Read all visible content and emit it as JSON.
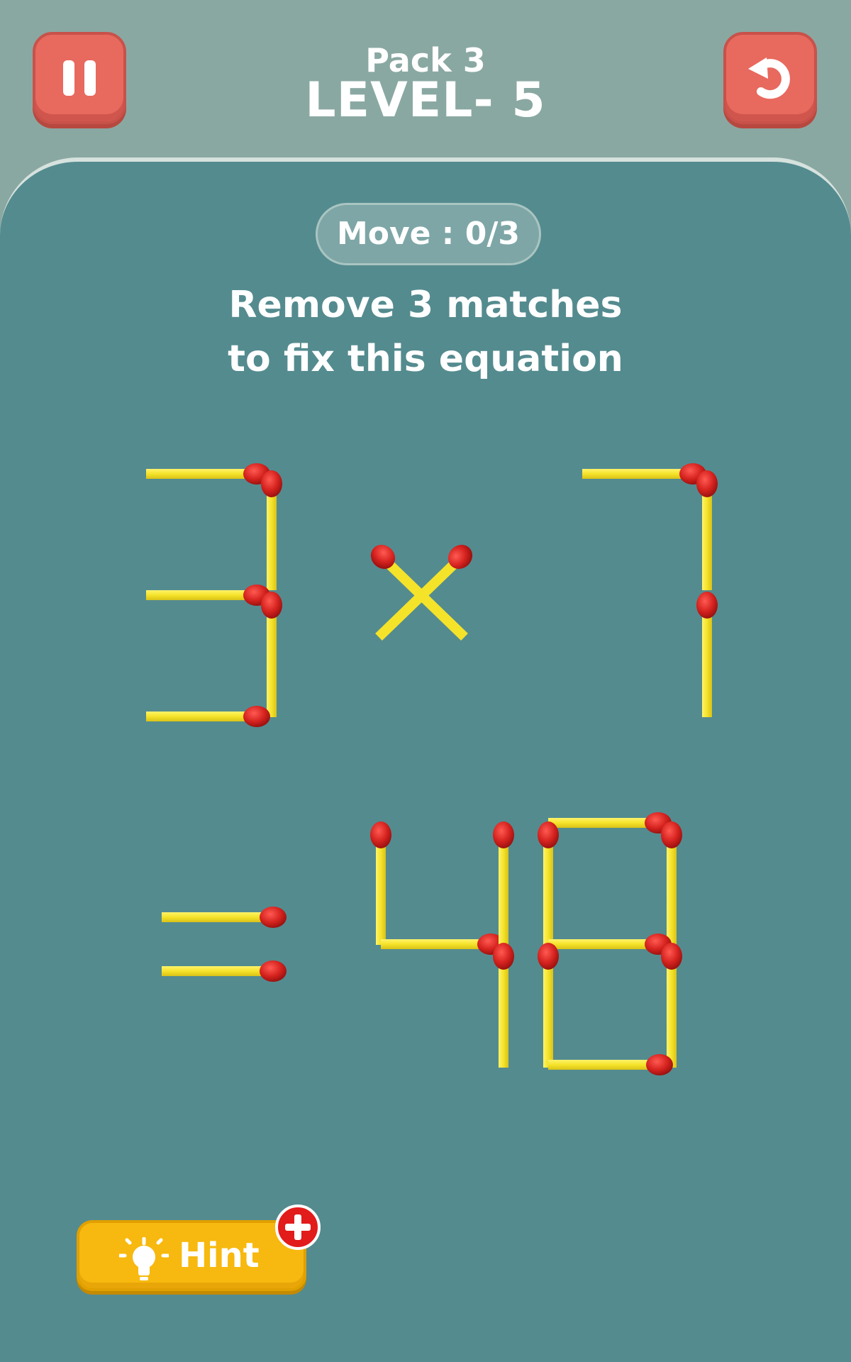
{
  "header": {
    "pack": "Pack 3",
    "level": "LEVEL- 5"
  },
  "move_counter": "Move : 0/3",
  "instruction": {
    "line1": "Remove 3 matches",
    "line2": "to fix this equation"
  },
  "equation": {
    "left_operand": "3",
    "operator": "×",
    "right_operand": "7",
    "equals": "=",
    "result": "48"
  },
  "hint_button": {
    "label": "Hint",
    "badge_icon": "plus-icon"
  },
  "colors": {
    "background": "#8aa8a2",
    "board": "#548b8f",
    "button_red": "#e8695e",
    "hint_yellow": "#f7b90f",
    "match_stick": "#f5e32a",
    "match_head": "#d0201e"
  }
}
